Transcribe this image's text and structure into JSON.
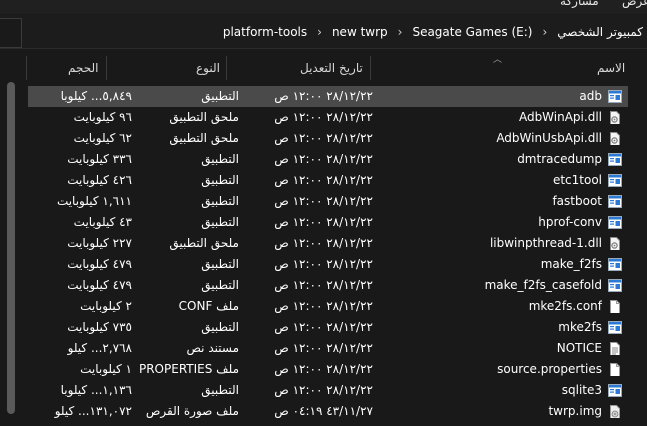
{
  "ribbon": {
    "tab_share": "مشاركة",
    "tab_view": "عرض"
  },
  "breadcrumb": [
    "كمبيوتر الشخصي",
    "Seagate Games (E:)",
    "new twrp",
    "platform-tools"
  ],
  "columns": {
    "name": "الاسم",
    "date": "تاريخ التعديل",
    "type": "النوع",
    "size": "الحجم"
  },
  "icons": {
    "application": "app-icon",
    "extension": "dll-icon",
    "file": "file-icon",
    "text": "text-file-icon",
    "disk": "disk-image-icon"
  },
  "files": [
    {
      "name": "adb",
      "date": "٢٨/١٢/٢٢ ١٢:٠٠ ص",
      "type": "التطبيق",
      "size": "٥,٨٤٩... كيلوبا",
      "icon": "app-icon",
      "selected": true
    },
    {
      "name": "AdbWinApi.dll",
      "date": "٢٨/١٢/٢٢ ١٢:٠٠ ص",
      "type": "ملحق التطبيق",
      "size": "٩٦ كيلوبايت",
      "icon": "dll-icon"
    },
    {
      "name": "AdbWinUsbApi.dll",
      "date": "٢٨/١٢/٢٢ ١٢:٠٠ ص",
      "type": "ملحق التطبيق",
      "size": "٦٢ كيلوبايت",
      "icon": "dll-icon"
    },
    {
      "name": "dmtracedump",
      "date": "٢٨/١٢/٢٢ ١٢:٠٠ ص",
      "type": "التطبيق",
      "size": "٣٣٦ كيلوبايت",
      "icon": "app-icon"
    },
    {
      "name": "etc1tool",
      "date": "٢٨/١٢/٢٢ ١٢:٠٠ ص",
      "type": "التطبيق",
      "size": "٤٢٦ كيلوبايت",
      "icon": "app-icon"
    },
    {
      "name": "fastboot",
      "date": "٢٨/١٢/٢٢ ١٢:٠٠ ص",
      "type": "التطبيق",
      "size": "١,٦١١ كيلوبايت",
      "icon": "app-icon"
    },
    {
      "name": "hprof-conv",
      "date": "٢٨/١٢/٢٢ ١٢:٠٠ ص",
      "type": "التطبيق",
      "size": "٤٣ كيلوبايت",
      "icon": "app-icon"
    },
    {
      "name": "libwinpthread-1.dll",
      "date": "٢٨/١٢/٢٢ ١٢:٠٠ ص",
      "type": "ملحق التطبيق",
      "size": "٢٢٧ كيلوبايت",
      "icon": "dll-icon"
    },
    {
      "name": "make_f2fs",
      "date": "٢٨/١٢/٢٢ ١٢:٠٠ ص",
      "type": "التطبيق",
      "size": "٤٧٩ كيلوبايت",
      "icon": "app-icon"
    },
    {
      "name": "make_f2fs_casefold",
      "date": "٢٨/١٢/٢٢ ١٢:٠٠ ص",
      "type": "التطبيق",
      "size": "٤٧٩ كيلوبايت",
      "icon": "app-icon"
    },
    {
      "name": "mke2fs.conf",
      "date": "٢٨/١٢/٢٢ ١٢:٠٠ ص",
      "type": "ملف CONF",
      "size": "٢ كيلوبايت",
      "icon": "file-icon"
    },
    {
      "name": "mke2fs",
      "date": "٢٨/١٢/٢٢ ١٢:٠٠ ص",
      "type": "التطبيق",
      "size": "٧٣٥ كيلوبايت",
      "icon": "app-icon"
    },
    {
      "name": "NOTICE",
      "date": "٢٨/١٢/٢٢ ١٢:٠٠ ص",
      "type": "مستند نص",
      "size": "٢,٧٦٨... كيلو",
      "icon": "text-file-icon"
    },
    {
      "name": "source.properties",
      "date": "٢٨/١٢/٢٢ ١٢:٠٠ ص",
      "type": "ملف PROPERTIES",
      "size": "١ كيلوبايت",
      "icon": "file-icon"
    },
    {
      "name": "sqlite3",
      "date": "٢٨/١٢/٢٢ ١٢:٠٠ ص",
      "type": "التطبيق",
      "size": "١,١٣٦... كيلوبا",
      "icon": "app-icon"
    },
    {
      "name": "twrp.img",
      "date": "٤٣/١١/٢٧ ٠٤:١٩ ص",
      "type": "ملف صورة القرص",
      "size": "١٣١,٠٧٢... كيلو",
      "icon": "disk-image-icon"
    }
  ]
}
